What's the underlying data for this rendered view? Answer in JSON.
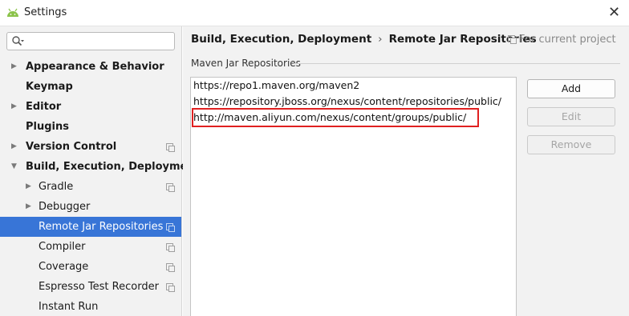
{
  "window": {
    "title": "Settings",
    "app_icon": "android-icon",
    "close_icon": "close-icon"
  },
  "sidebar": {
    "search": {
      "value": "",
      "placeholder": "",
      "icon": "search-icon"
    },
    "items": [
      {
        "label": "Appearance & Behavior",
        "level": 1,
        "arrow": "collapsed",
        "project_icon": false
      },
      {
        "label": "Keymap",
        "level": 1,
        "arrow": "none",
        "project_icon": false
      },
      {
        "label": "Editor",
        "level": 1,
        "arrow": "collapsed",
        "project_icon": false
      },
      {
        "label": "Plugins",
        "level": 1,
        "arrow": "none",
        "project_icon": false
      },
      {
        "label": "Version Control",
        "level": 1,
        "arrow": "collapsed",
        "project_icon": true
      },
      {
        "label": "Build, Execution, Deployment",
        "level": 1,
        "arrow": "expanded",
        "project_icon": false
      },
      {
        "label": "Gradle",
        "level": 2,
        "arrow": "collapsed",
        "project_icon": true
      },
      {
        "label": "Debugger",
        "level": 2,
        "arrow": "collapsed",
        "project_icon": false
      },
      {
        "label": "Remote Jar Repositories",
        "level": 2,
        "arrow": "none",
        "project_icon": true,
        "selected": true
      },
      {
        "label": "Compiler",
        "level": 2,
        "arrow": "none",
        "project_icon": true
      },
      {
        "label": "Coverage",
        "level": 2,
        "arrow": "none",
        "project_icon": true
      },
      {
        "label": "Espresso Test Recorder",
        "level": 2,
        "arrow": "none",
        "project_icon": true
      },
      {
        "label": "Instant Run",
        "level": 2,
        "arrow": "none",
        "project_icon": false
      }
    ]
  },
  "main": {
    "breadcrumb": {
      "parent": "Build, Execution, Deployment",
      "separator": "›",
      "current": "Remote Jar Repositories"
    },
    "scope_hint": "For current project",
    "section_title": "Maven Jar Repositories",
    "repositories": [
      "https://repo1.maven.org/maven2",
      "https://repository.jboss.org/nexus/content/repositories/public/",
      "http://maven.aliyun.com/nexus/content/groups/public/"
    ],
    "highlight_color": "#e02020",
    "buttons": {
      "add": "Add",
      "edit": "Edit",
      "remove": "Remove"
    }
  },
  "colors": {
    "selection": "#3875d7",
    "panel_bg": "#f2f2f2"
  }
}
